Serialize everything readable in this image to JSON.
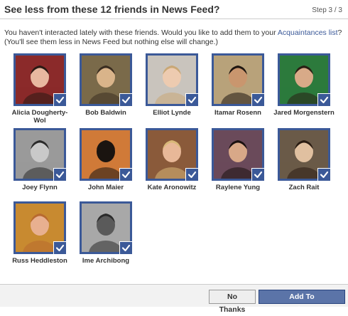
{
  "dialog": {
    "title": "See less from these 12 friends in News Feed?",
    "step": "Step 3 / 3",
    "intro_before_link": "You haven't interacted lately with these friends. Would you like to add them to your ",
    "intro_link": "Acquaintances list",
    "intro_after_link": "?",
    "intro_line2": "(You'll see them less in News Feed but nothing else will change.)"
  },
  "friends": [
    {
      "name": "Alicia Dougherty-Wol",
      "checked": true,
      "bg": "#8b2a2a",
      "skin": "#e8b8a0",
      "hair": "#2a1a14"
    },
    {
      "name": "Bob Baldwin",
      "checked": true,
      "bg": "#7a6a4a",
      "skin": "#d9b48a",
      "hair": "#3a2d20"
    },
    {
      "name": "Elliot Lynde",
      "checked": true,
      "bg": "#c9c4bd",
      "skin": "#edcbb0",
      "hair": "#c9a876"
    },
    {
      "name": "Itamar Rosenn",
      "checked": true,
      "bg": "#b8a27a",
      "skin": "#c9966e",
      "hair": "#1e1610"
    },
    {
      "name": "Jared Morgenstern",
      "checked": true,
      "bg": "#2c7a3c",
      "skin": "#d8aa88",
      "hair": "#2a1f14"
    },
    {
      "name": "Joey Flynn",
      "checked": true,
      "bg": "#9a9a9a",
      "skin": "#c9c9c9",
      "hair": "#2a2a2a"
    },
    {
      "name": "John Maier",
      "checked": true,
      "bg": "#d07a38",
      "skin": "#1a1410",
      "hair": "#1a1410"
    },
    {
      "name": "Kate Aronowitz",
      "checked": true,
      "bg": "#8a5a3a",
      "skin": "#e8b898",
      "hair": "#d8b878"
    },
    {
      "name": "Raylene Yung",
      "checked": true,
      "bg": "#6a4a5a",
      "skin": "#d8a888",
      "hair": "#1a1010"
    },
    {
      "name": "Zach Rait",
      "checked": true,
      "bg": "#6a5a48",
      "skin": "#e0c0a0",
      "hair": "#2a1c12"
    },
    {
      "name": "Russ Heddleston",
      "checked": true,
      "bg": "#c88a30",
      "skin": "#e8b090",
      "hair": "#b86a30"
    },
    {
      "name": "Ime Archibong",
      "checked": true,
      "bg": "#a8a8a8",
      "skin": "#5a5a5a",
      "hair": "#2a2a2a"
    }
  ],
  "footer": {
    "no_thanks": "No Thanks",
    "add": "Add To Acquaintances"
  }
}
